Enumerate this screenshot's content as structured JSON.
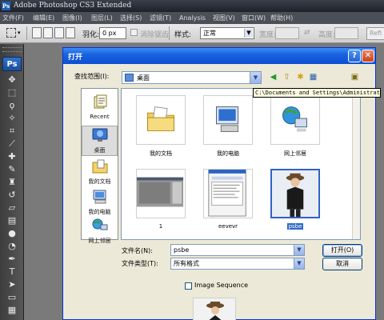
{
  "app": {
    "title": "Adobe Photoshop CS3 Extended",
    "logo": "Ps"
  },
  "menu": [
    {
      "label": "文件(F)"
    },
    {
      "label": "编辑(E)"
    },
    {
      "label": "图像(I)"
    },
    {
      "label": "图层(L)"
    },
    {
      "label": "选择(S)"
    },
    {
      "label": "滤镜(T)"
    },
    {
      "label": "Analysis"
    },
    {
      "label": "视图(V)"
    },
    {
      "label": "窗口(W)"
    },
    {
      "label": "帮助(H)"
    }
  ],
  "options_bar": {
    "feather_label": "羽化:",
    "feather_value": "0 px",
    "antialias_label": "消除锯齿",
    "style_label": "样式:",
    "style_value": "正常",
    "width_label": "宽度:",
    "height_label": "高度:",
    "refine_label": "Refi"
  },
  "dialog": {
    "title": "打开",
    "help_glyph": "?",
    "close_glyph": "✕",
    "look_in_label": "查找范围(I):",
    "look_in_value": "桌面",
    "tooltip": "C:\\Documents and Settings\\Administrator\\",
    "places": [
      {
        "label": "Recent",
        "icon": "recent-documents-icon"
      },
      {
        "label": "桌面",
        "icon": "desktop-icon",
        "active": true
      },
      {
        "label": "我的文档",
        "icon": "my-documents-icon"
      },
      {
        "label": "我的电脑",
        "icon": "my-computer-icon"
      },
      {
        "label": "网上邻居",
        "icon": "network-places-icon"
      }
    ],
    "files": [
      {
        "name": "我的文档",
        "icon": "my-documents-folder-icon"
      },
      {
        "name": "我的电脑",
        "icon": "my-computer-icon"
      },
      {
        "name": "网上邻居",
        "icon": "network-places-icon"
      },
      {
        "name": "1",
        "icon": "image-thumbnail"
      },
      {
        "name": "eevevr",
        "icon": "image-thumbnail"
      },
      {
        "name": "psbe",
        "icon": "image-thumbnail",
        "selected": true
      }
    ],
    "filename_label": "文件名(N):",
    "filename_value": "psbe",
    "filetype_label": "文件类型(T):",
    "filetype_value": "所有格式",
    "open_button": "打开(O)",
    "cancel_button": "取消",
    "image_sequence_label": "Image Sequence",
    "image_sequence_checked": false
  },
  "colors": {
    "dialog_bg": "#ece9d8",
    "titlebar_blue": "#0a4fd2",
    "selection_blue": "#316ac5"
  }
}
